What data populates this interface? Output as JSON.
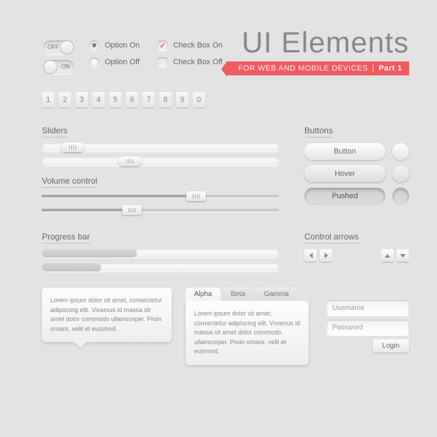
{
  "header": {
    "title": "UI Elements",
    "subtitle": "FOR WEB AND MOBILE DEVICES",
    "part": "Part 1"
  },
  "toggles": {
    "off": "OFF",
    "on": "ON"
  },
  "radios": {
    "on": "Option On",
    "off": "Option Off"
  },
  "checks": {
    "on": "Check Box On",
    "off": "Check Box Off"
  },
  "digits": [
    "1",
    "2",
    "3",
    "4",
    "5",
    "6",
    "7",
    "8",
    "9",
    "0"
  ],
  "sections": {
    "sliders": "Sliders",
    "volume": "Volume control",
    "progress": "Progress bar",
    "buttons": "Buttons",
    "arrows": "Control arrows"
  },
  "sliders": [
    {
      "pos": 8
    },
    {
      "pos": 32
    }
  ],
  "volume": [
    {
      "fill": 65
    },
    {
      "fill": 38
    }
  ],
  "progress": [
    {
      "value": 40
    },
    {
      "value": 25
    }
  ],
  "buttons": {
    "normal": "Button",
    "hover": "Hover",
    "pushed": "Pushed"
  },
  "tabs": {
    "items": [
      "Alpha",
      "Beta",
      "Gamma"
    ],
    "body": "Lorem ipsum dolor sit amet, consectetur adipiscing elit. Vivamus id massa sit amet dolor commodo ullamcorper. Proin ornare, velit et euismod."
  },
  "tooltip": "Lorem ipsum dolor sit amet, consectetur adipiscing elit. Vivamus id massa sit amet dolor commodo ullamcorper. Proin ornare, velit et euismod.",
  "login": {
    "username": "Username",
    "password": "Password",
    "button": "Login"
  }
}
